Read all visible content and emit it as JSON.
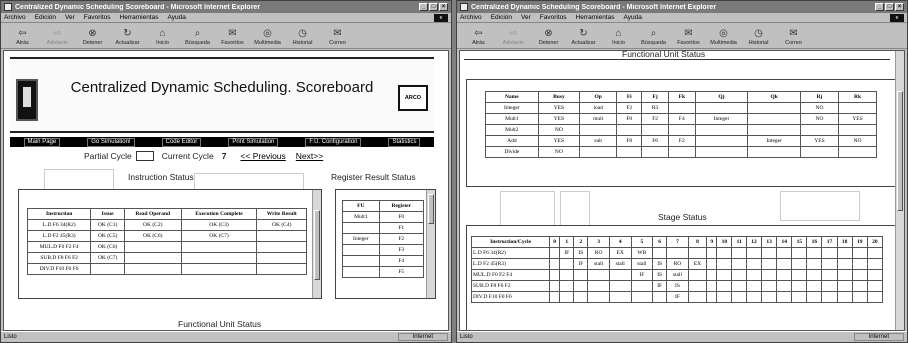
{
  "windows": [
    {
      "title": "Centralized Dynamic Scheduling  Scoreboard - Microsoft Internet Explorer"
    },
    {
      "title": "Centralized Dynamic Scheduling  Scoreboard - Microsoft Internet Explorer"
    }
  ],
  "menu": [
    "Archivo",
    "Edición",
    "Ver",
    "Favoritos",
    "Herramientas",
    "Ayuda"
  ],
  "toolbar": [
    {
      "label": "Atrás",
      "icon": "back-icon",
      "glyph": "⇦"
    },
    {
      "label": "Adelante",
      "icon": "forward-icon",
      "glyph": "⇨"
    },
    {
      "label": "Detener",
      "icon": "stop-icon",
      "glyph": "⊗"
    },
    {
      "label": "Actualizar",
      "icon": "refresh-icon",
      "glyph": "↻"
    },
    {
      "label": "Inicio",
      "icon": "home-icon",
      "glyph": "⌂"
    },
    {
      "label": "Búsqueda",
      "icon": "search-icon",
      "glyph": "⌕"
    },
    {
      "label": "Favoritos",
      "icon": "favorites-icon",
      "glyph": "✉"
    },
    {
      "label": "Multimedia",
      "icon": "media-icon",
      "glyph": "◎"
    },
    {
      "label": "Historial",
      "icon": "history-icon",
      "glyph": "◷"
    },
    {
      "label": "Correo",
      "icon": "mail-icon",
      "glyph": "✉"
    }
  ],
  "status": {
    "left": "Listo",
    "zone": "Internet"
  },
  "page": {
    "title": "Centralized Dynamic Scheduling. Scoreboard",
    "logo_text": "ARCO",
    "nav": [
      "Main Page",
      "Go Simulation!",
      "Code Editor",
      "Print Simulation",
      "F.U. Configuration",
      "Statistics"
    ],
    "partial_cycle_label": "Partial Cycle",
    "current_cycle_label": "Current Cycle",
    "current_cycle_value": "7",
    "prev_link": "<< Previous",
    "next_link": "Next>>",
    "instruction_status": {
      "heading": "Instruction Status",
      "columns": [
        "Instruction",
        "Issue",
        "Read Operand",
        "Execution Complete",
        "Write Result"
      ],
      "rows": [
        [
          "L.D F6 34(R2)",
          "OK (C1)",
          "OK (C2)",
          "OK (C3)",
          "OK (C4)"
        ],
        [
          "L.D F2 45(R3)",
          "OK (C5)",
          "OK (C6)",
          "OK (C7)",
          ""
        ],
        [
          "MUL.D F0 F2 F4",
          "OK (C6)",
          "",
          "",
          ""
        ],
        [
          "SUB.D F8 F6 F2",
          "OK (C7)",
          "",
          "",
          ""
        ],
        [
          "DIV.D F10 F0 F6",
          "",
          "",
          "",
          ""
        ]
      ]
    },
    "register_status": {
      "heading": "Register Result Status",
      "columns": [
        "FU",
        "Register"
      ],
      "rows": [
        [
          "Mult1",
          "F0"
        ],
        [
          "",
          "F1"
        ],
        [
          "Integer",
          "F2"
        ],
        [
          "",
          "F3"
        ],
        [
          "",
          "F4"
        ],
        [
          "",
          "F5"
        ]
      ]
    },
    "functional_unit_heading": "Functional Unit Status",
    "functional_unit_status": {
      "columns": [
        "Name",
        "Busy",
        "Op",
        "Fi",
        "Fj",
        "Fk",
        "Qj",
        "Qk",
        "Rj",
        "Rk"
      ],
      "rows": [
        [
          "Integer",
          "YES",
          "load",
          "F2",
          "R3",
          "",
          "",
          "",
          "NO",
          ""
        ],
        [
          "Mult1",
          "YES",
          "mult",
          "F0",
          "F2",
          "F4",
          "Integer",
          "",
          "NO",
          "YES"
        ],
        [
          "Mult2",
          "NO",
          "",
          "",
          "",
          "",
          "",
          "",
          "",
          ""
        ],
        [
          "Add",
          "YES",
          "sub",
          "F8",
          "F6",
          "F2",
          "",
          "Integer",
          "YES",
          "NO"
        ],
        [
          "Divide",
          "NO",
          "",
          "",
          "",
          "",
          "",
          "",
          "",
          ""
        ]
      ]
    },
    "stage_status": {
      "heading": "Stage Status",
      "corner": "Instruction/Cycle",
      "cycles": [
        "0",
        "1",
        "2",
        "3",
        "4",
        "5",
        "6",
        "7",
        "8",
        "9",
        "10",
        "11",
        "12",
        "13",
        "14",
        "15",
        "16",
        "17",
        "18",
        "19",
        "20"
      ],
      "rows": [
        {
          "instr": "L.D F6 34(R2)",
          "cells": [
            "",
            "IF",
            "IS",
            "RO",
            "EX",
            "WB",
            "",
            "",
            "",
            "",
            "",
            "",
            "",
            "",
            "",
            "",
            "",
            "",
            "",
            "",
            ""
          ]
        },
        {
          "instr": "L.D F2 45(R3)",
          "cells": [
            "",
            "",
            "IF",
            "stall",
            "stall",
            "stall",
            "IS",
            "RO",
            "EX",
            "",
            "",
            "",
            "",
            "",
            "",
            "",
            "",
            "",
            "",
            "",
            ""
          ]
        },
        {
          "instr": "MUL.D F0 F2 F4",
          "cells": [
            "",
            "",
            "",
            "",
            "",
            "IF",
            "IS",
            "stall",
            "",
            "",
            "",
            "",
            "",
            "",
            "",
            "",
            "",
            "",
            "",
            "",
            ""
          ]
        },
        {
          "instr": "SUB.D F8 F6 F2",
          "cells": [
            "",
            "",
            "",
            "",
            "",
            "",
            "IF",
            "IS",
            "",
            "",
            "",
            "",
            "",
            "",
            "",
            "",
            "",
            "",
            "",
            "",
            ""
          ]
        },
        {
          "instr": "DIV.D F10 F0 F6",
          "cells": [
            "",
            "",
            "",
            "",
            "",
            "",
            "",
            "IF",
            "",
            "",
            "",
            "",
            "",
            "",
            "",
            "",
            "",
            "",
            "",
            "",
            ""
          ]
        }
      ]
    }
  }
}
